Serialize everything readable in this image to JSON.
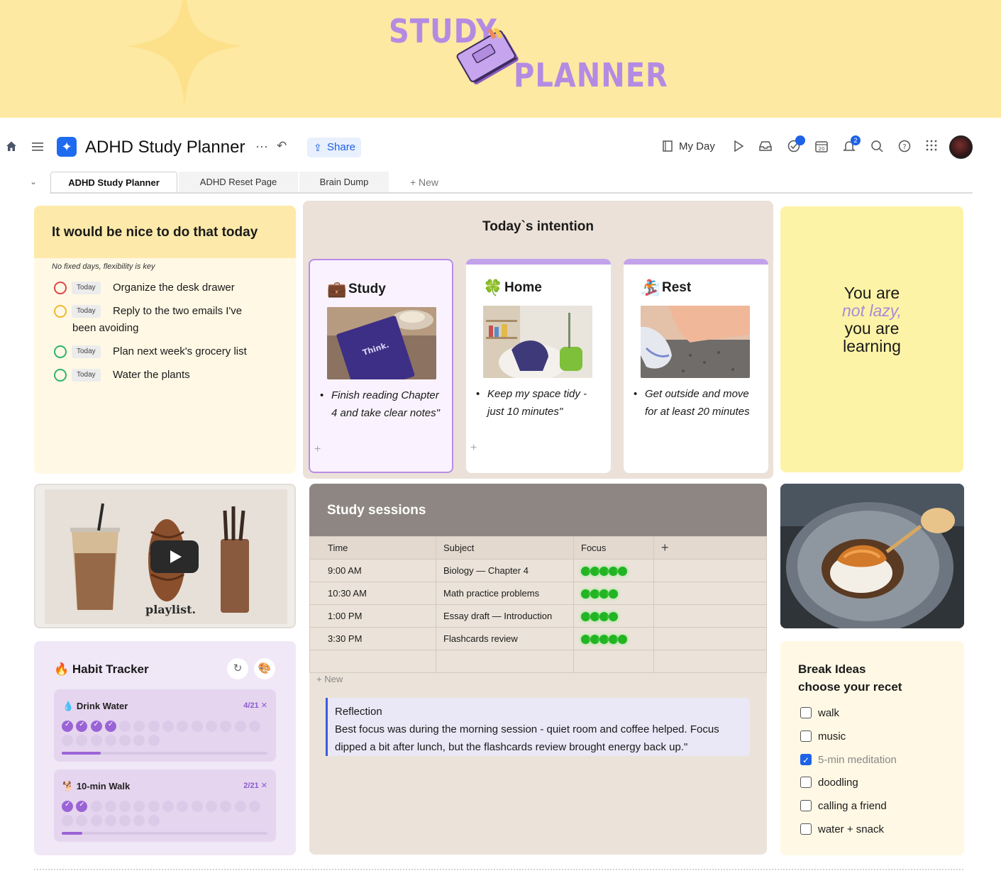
{
  "banner": {
    "word1": "STUDY",
    "word2": "PLANNER"
  },
  "topbar": {
    "title": "ADHD Study Planner",
    "share_label": "Share",
    "myday_label": "My Day",
    "notif_count": "2"
  },
  "tabs": [
    {
      "label": "ADHD Study Planner",
      "active": true
    },
    {
      "label": "ADHD Reset Page",
      "active": false
    },
    {
      "label": "Brain Dump",
      "active": false
    }
  ],
  "new_tab_label": "New",
  "todo": {
    "title": "It would be nice to do that today",
    "subtitle": "No fixed days, flexibility is key",
    "chip": "Today",
    "items": [
      {
        "text": "Organize the desk drawer",
        "color": "#e0454a"
      },
      {
        "text": "Reply to the two emails I've",
        "text2": "been avoiding",
        "color": "#f0b830"
      },
      {
        "text": "Plan next week's grocery list",
        "color": "#2fb36b"
      },
      {
        "text": "Water the plants",
        "color": "#2fb36b"
      }
    ]
  },
  "intention": {
    "title": "Today`s intention",
    "cards": [
      {
        "title": "Study",
        "icon": "briefcase-icon",
        "note": "Finish reading Chapter 4 and take clear notes\"",
        "book_text": "Think."
      },
      {
        "title": "Home",
        "icon": "clover-icon",
        "note": "Keep my space tidy - just 10 minutes\""
      },
      {
        "title": "Rest",
        "icon": "skater-icon",
        "note": "Get outside and move for at least 20 minutes"
      }
    ]
  },
  "motto": {
    "line1": "You are",
    "line2": "not lazy,",
    "line3": "you are",
    "line4": "learning"
  },
  "video": {
    "caption": "playlist."
  },
  "habits": {
    "title": "Habit Tracker",
    "items": [
      {
        "name": "Drink Water",
        "count": "4/21",
        "done": 4,
        "total": 21,
        "progress": 0.19
      },
      {
        "name": "10-min Walk",
        "count": "2/21",
        "done": 2,
        "total": 21,
        "progress": 0.1
      }
    ]
  },
  "sessions": {
    "title": "Study sessions",
    "columns": [
      "Time",
      "Subject",
      "Focus"
    ],
    "rows": [
      {
        "time": "9:00 AM",
        "subject": "Biology — Chapter 4",
        "focus": 5
      },
      {
        "time": "10:30 AM",
        "subject": "Math practice problems",
        "focus": 4
      },
      {
        "time": "1:00 PM",
        "subject": "Essay draft — Introduction",
        "focus": 4
      },
      {
        "time": "3:30 PM",
        "subject": "Flashcards review",
        "focus": 5
      }
    ],
    "new_label": "New",
    "reflection_title": "Reflection",
    "reflection_body": "Best focus was during the morning session - quiet room and coffee helped. Focus dipped a bit after lunch, but the flashcards review brought energy back up.\""
  },
  "break_ideas": {
    "title1": "Break Ideas",
    "title2": "choose your recet",
    "items": [
      {
        "label": "walk",
        "checked": false
      },
      {
        "label": "music",
        "checked": false
      },
      {
        "label": "5-min meditation",
        "checked": true
      },
      {
        "label": "doodling",
        "checked": false
      },
      {
        "label": "calling a friend",
        "checked": false
      },
      {
        "label": "water + snack",
        "checked": false
      }
    ]
  }
}
